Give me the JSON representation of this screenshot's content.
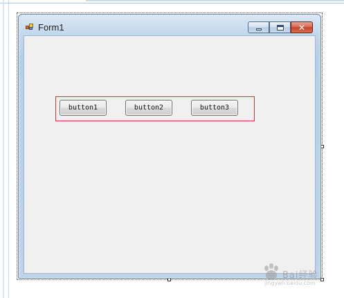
{
  "window": {
    "title": "Form1",
    "icon": "form-app-icon",
    "caption_buttons": {
      "minimize_icon": "minimize-icon",
      "maximize_icon": "maximize-icon",
      "close_icon": "close-icon",
      "close_glyph": "✕"
    }
  },
  "form": {
    "buttons": [
      {
        "label": "button1"
      },
      {
        "label": "button2"
      },
      {
        "label": "button3"
      }
    ],
    "highlight_color": "#cc3333"
  },
  "watermark": {
    "text": "Bai经验",
    "sub": "jingyan.baidu.com"
  },
  "colors": {
    "titlebar": "#c4d8ec",
    "client_background": "#f0f0f0",
    "close_button": "#c8432b"
  }
}
